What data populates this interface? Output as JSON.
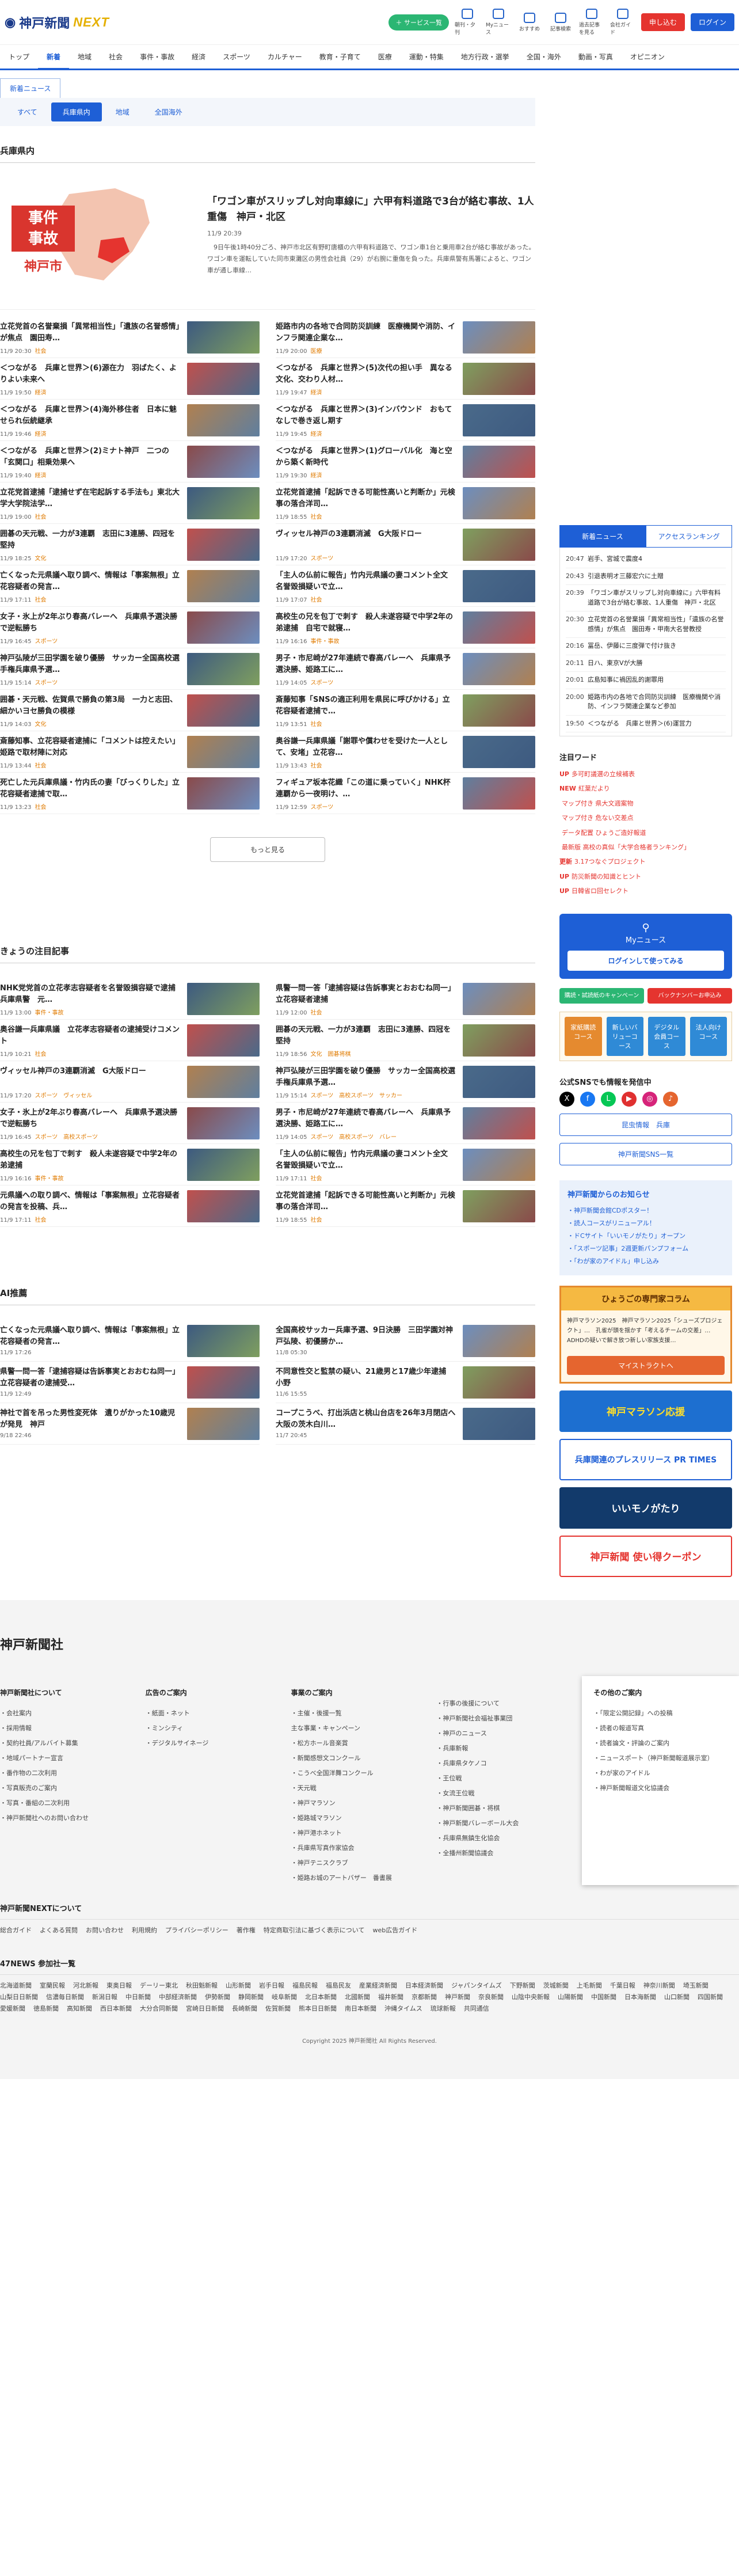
{
  "header": {
    "logo_text": "神戸新聞",
    "logo_next": "NEXT",
    "service_button": "＋ サービス一覧",
    "icons": [
      "朝刊・夕刊",
      "Myニュース",
      "おすすめ",
      "記事検索",
      "過去記事を見る",
      "会社ガイド"
    ],
    "signup": "申し込む",
    "login": "ログイン"
  },
  "nav": [
    "トップ",
    "新着",
    "地域",
    "社会",
    "事件・事故",
    "経済",
    "スポーツ",
    "カルチャー",
    "教育・子育て",
    "医療",
    "運動・特集",
    "地方行政・選挙",
    "全国・海外",
    "動画・写真",
    "オピニオン"
  ],
  "tabs": {
    "main": "新着ニュース",
    "sub": [
      "すべて",
      "兵庫県内",
      "地域",
      "全国海外"
    ]
  },
  "section": "兵庫県内",
  "featured": {
    "title": "「ワゴン車がスリップし対向車線に」六甲有料道路で3台が絡む事故、1人重傷　神戸・北区",
    "time": "11/9 20:39",
    "summary": "　9日午後1時40分ごろ、神戸市北区有野町唐櫃の六甲有料道路で、ワゴン車1台と乗用車2台が絡む事故があった。ワゴン車を運転していた同市東灘区の男性会社員（29）が右腕に重傷を負った。兵庫県警有馬署によると、ワゴン車が通し車線…",
    "badge_lines": [
      "事件",
      "事故"
    ],
    "badge_city": "神戸市"
  },
  "articles": [
    {
      "title": "立花党首の名誉棄損「異常相当性」「遺族の名誉感情」が焦点　園田寿…",
      "time": "11/9 20:30",
      "cat": "社会"
    },
    {
      "title": "姫路市内の各地で合同防災訓練　医療機関や消防、インフラ関連企業な…",
      "time": "11/9 20:00",
      "cat": "医療"
    },
    {
      "title": "＜つながる　兵庫と世界＞(6)源在力　羽ばたく、よりよい未来へ",
      "time": "11/9 19:50",
      "cat": "経済"
    },
    {
      "title": "＜つながる　兵庫と世界＞(5)次代の担い手　異なる文化、交わり人材…",
      "time": "11/9 19:47",
      "cat": "経済"
    },
    {
      "title": "＜つながる　兵庫と世界＞(4)海外移住者　日本に魅せられ伝統継承",
      "time": "11/9 19:46",
      "cat": "経済"
    },
    {
      "title": "＜つながる　兵庫と世界＞(3)インバウンド　おもてなしで巻き返し期す",
      "time": "11/9 19:45",
      "cat": "経済"
    },
    {
      "title": "＜つながる　兵庫と世界＞(2)ミナト神戸　二つの「玄関口」相乗効果へ",
      "time": "11/9 19:40",
      "cat": "経済"
    },
    {
      "title": "＜つながる　兵庫と世界＞(1)グローバル化　海と空から築く新時代",
      "time": "11/9 19:30",
      "cat": "経済"
    },
    {
      "title": "立花党首逮捕「逮捕せず在宅起訴する手法も」東北大学大学院法学…",
      "time": "11/9 19:00",
      "cat": "社会"
    },
    {
      "title": "立花党首逮捕「起訴できる可能性高いと判断か」元検事の落合洋司…",
      "time": "11/9 18:55",
      "cat": "社会"
    },
    {
      "title": "囲碁の天元戦、一力が3連覇　志田に3連勝、四冠を堅持",
      "time": "11/9 18:25",
      "cat": "文化"
    },
    {
      "title": "ヴィッセル神戸の3連覇消滅　G大阪ドロー",
      "time": "11/9 17:20",
      "cat": "スポーツ"
    },
    {
      "title": "亡くなった元県議へ取り調べ、情報は「事案無根」立花容疑者の発言…",
      "time": "11/9 17:11",
      "cat": "社会"
    },
    {
      "title": "「主人の仏前に報告」竹内元県議の妻コメント全文　名誉毀損疑いで立…",
      "time": "11/9 17:07",
      "cat": "社会"
    },
    {
      "title": "女子・氷上が2年ぶり春高バレーへ　兵庫県予選決勝で逆転勝ち",
      "time": "11/9 16:45",
      "cat": "スポーツ"
    },
    {
      "title": "高校生の兄を包丁で刺す　殺人未遂容疑で中学2年の弟逮捕　自宅で就寝…",
      "time": "11/9 16:16",
      "cat": "事件・事故"
    },
    {
      "title": "神戸弘陵が三田学園を破り優勝　サッカー全国高校選手権兵庫県予選…",
      "time": "11/9 15:14",
      "cat": "スポーツ"
    },
    {
      "title": "男子・市尼崎が27年連続で春高バレーへ　兵庫県予選決勝、姫路工に…",
      "time": "11/9 14:05",
      "cat": "スポーツ"
    },
    {
      "title": "囲碁・天元戦、佐賀県で勝負の第3局　一力と志田、細かいヨセ勝負の模様",
      "time": "11/9 14:03",
      "cat": "文化"
    },
    {
      "title": "斎藤知事「SNSの適正利用を県民に呼びかける」立花容疑者逮捕で…",
      "time": "11/9 13:51",
      "cat": "社会"
    },
    {
      "title": "斎藤知事、立花容疑者逮捕に「コメントは控えたい」姫路で取材陣に対応",
      "time": "11/9 13:44",
      "cat": "社会"
    },
    {
      "title": "奥谷謙一兵庫県議「謝罪や償わせを受けた一人として、安堵」立花容…",
      "time": "11/9 13:43",
      "cat": "社会"
    },
    {
      "title": "死亡した元兵庫県議・竹内氏の妻「びっくりした」立花容疑者逮捕で取…",
      "time": "11/9 13:23",
      "cat": "社会"
    },
    {
      "title": "フィギュア坂本花織「この道に乗っていく」NHK杯連覇から一夜明け、…",
      "time": "11/9 12:59",
      "cat": "スポーツ"
    }
  ],
  "more": "もっと見る",
  "picks_title": "きょうの注目記事",
  "picks": [
    {
      "title": "NHK党党首の立花孝志容疑者を名誉毀損容疑で逮捕　兵庫県警　元…",
      "time": "11/9 13:00",
      "cat": "事件・事故"
    },
    {
      "title": "県警一問一答「逮捕容疑は告訴事実とおおむね同一」立花容疑者逮捕",
      "time": "11/9 12:00",
      "cat": "社会"
    },
    {
      "title": "奥谷謙一兵庫県議　立花孝志容疑者の逮捕受けコメント",
      "time": "11/9 10:21",
      "cat": "社会"
    },
    {
      "title": "囲碁の天元戦、一力が3連覇　志田に3連勝、四冠を堅持",
      "time": "11/9 18:56",
      "cat": "文化　囲碁将棋"
    },
    {
      "title": "ヴィッセル神戸の3連覇消滅　G大阪ドロー",
      "time": "11/9 17:20",
      "cat": "スポーツ　ヴィッセル"
    },
    {
      "title": "神戸弘陵が三田学園を破り優勝　サッカー全国高校選手権兵庫県予選…",
      "time": "11/9 15:14",
      "cat": "スポーツ　高校スポーツ　サッカー"
    },
    {
      "title": "女子・氷上が2年ぶり春高バレーへ　兵庫県予選決勝で逆転勝ち",
      "time": "11/9 16:45",
      "cat": "スポーツ　高校スポーツ"
    },
    {
      "title": "男子・市尼崎が27年連続で春高バレーへ　兵庫県予選決勝、姫路工に…",
      "time": "11/9 14:05",
      "cat": "スポーツ　高校スポーツ　バレー"
    },
    {
      "title": "高校生の兄を包丁で刺す　殺人未遂容疑で中学2年の弟逮捕",
      "time": "11/9 16:16",
      "cat": "事件・事故"
    },
    {
      "title": "「主人の仏前に報告」竹内元県議の妻コメント全文　名誉毀損疑いで立…",
      "time": "11/9 17:11",
      "cat": "社会"
    },
    {
      "title": "元県議への取り調べ、情報は「事案無根」立花容疑者の発言を投稿、兵…",
      "time": "11/9 17:11",
      "cat": "社会"
    },
    {
      "title": "立花党首逮捕「起訴できる可能性高いと判断か」元検事の落合洋司…",
      "time": "11/9 18:55",
      "cat": "社会"
    }
  ],
  "ai_title": "AI推薦",
  "ai": [
    {
      "title": "亡くなった元県議へ取り調べ、情報は「事案無根」立花容疑者の発言…",
      "time": "11/9 17:26",
      "cat": ""
    },
    {
      "title": "全国高校サッカー兵庫予選、9日決勝　三田学園対神戸弘陵、初優勝か…",
      "time": "11/8 05:30",
      "cat": ""
    },
    {
      "title": "県警一問一答「逮捕容疑は告訴事実とおおむね同一」立花容疑者の逮捕受…",
      "time": "11/9 12:49",
      "cat": ""
    },
    {
      "title": "不同意性交と監禁の疑い、21歳男と17歳少年逮捕　小野",
      "time": "11/6 15:55",
      "cat": ""
    },
    {
      "title": "神社で首を吊った男性変死体　遺りがかった10歳児が発見　神戸",
      "time": "9/18 22:46",
      "cat": ""
    },
    {
      "title": "コープこうべ、打出浜店と桃山台店を26年3月閉店へ　大阪の茨木白川…",
      "time": "11/7 20:45",
      "cat": ""
    }
  ],
  "side": {
    "tabs": [
      "新着ニュース",
      "アクセスランキング"
    ],
    "ranking": [
      {
        "t": "20:47",
        "s": "岩手、宮城で震度4"
      },
      {
        "t": "20:43",
        "s": "引退表明オ三藤宏穴に土贈"
      },
      {
        "t": "20:39",
        "s": "「ワゴン車がスリップし対向車線に」六甲有料道路で3台が絡む事故、1人重傷　神戸・北区"
      },
      {
        "t": "20:30",
        "s": "立花党首の名誉棄損「異常相当性」「遺族の名誉感情」が焦点　園田寿・甲南大名誉教授"
      },
      {
        "t": "20:16",
        "s": "冨岳、伊藤に三度弾で付け抜き"
      },
      {
        "t": "20:11",
        "s": "日ハ、東京Vが大勝"
      },
      {
        "t": "20:01",
        "s": "広島知事に禍因乱的謝罪用"
      },
      {
        "t": "20:00",
        "s": "姫路市内の各地で合同防災訓練　医療機関や消防、インフラ関連企業など参加"
      },
      {
        "t": "19:50",
        "s": "＜つながる　兵庫と世界＞(6)運営力"
      }
    ],
    "kw_title": "注目ワード",
    "keywords": [
      {
        "tag": "UP",
        "text": "多可町議選の立候補表"
      },
      {
        "tag": "NEW",
        "text": "紅葉だより"
      },
      {
        "tag": "",
        "text": "マップ付き 県大文週案物"
      },
      {
        "tag": "",
        "text": "マップ付き 危ない交差点"
      },
      {
        "tag": "",
        "text": "データ配置 ひょうご造好報道"
      },
      {
        "tag": "",
        "text": "最新版 高校の真似「大学合格者ランキング」"
      },
      {
        "tag": "更新",
        "text": "3.17つなぐプロジェクト"
      },
      {
        "tag": "UP",
        "text": "防災新聞の知識とヒント"
      },
      {
        "tag": "UP",
        "text": "日韓省ロ回セレクト"
      }
    ],
    "mynews": "Myニュース",
    "mynews_btn": "ログインして使ってみる",
    "pills": [
      "購読・試読紙のキャンペーン",
      "バックナンバーお申込み"
    ],
    "digital_title": "デジタル",
    "digital": [
      "家紙購読コース",
      "新しいバリューコース",
      "デジタル会員コース",
      "法人向けコース"
    ],
    "sns_title": "公式SNSでも情報を発信中",
    "sns_buttons": [
      "昆虫情報　兵庫",
      "神戸新聞SNS一覧"
    ],
    "notice_title": "神戸新聞からのお知らせ",
    "notices": [
      "・神戸新聞会館CDポスター！",
      "・読人コースがリニューアル！",
      "・ドCサイト「いいモノがたり」オープン",
      "・「スポーツ記事」2週更新パンプフォーム",
      "・「わが家のアイドル」申し込み"
    ],
    "column_head": "ひょうごの専門家コラム",
    "column_body": "神戸マラソン2025　神戸マラソン2025「シューズプロジェクト」…　孔雀が頭を揺かす「考えるチームの交差」…　ADHDの疑いで解き放つ新しい家族支援…",
    "column_btn": "マイストラクトへ",
    "banners": [
      "神戸マラソン応援",
      "兵庫関連のプレスリリース PR TIMES",
      "いいモノがたり",
      "神戸新聞 使い得クーポン"
    ]
  },
  "footer": {
    "logo": "神戸新聞社",
    "cols": [
      {
        "h": "神戸新聞社について",
        "items": [
          "・会社案内",
          "・採用情報",
          "・契約社員/アルバイト募集",
          "・地域パートナー宣言",
          "・番作物の二次利用",
          "・写真販売のご案内",
          "・写真・番組の二次利用",
          "・神戸新聞社へのお問い合わせ"
        ]
      },
      {
        "h": "広告のご案内",
        "items": [
          "・紙面・ネット",
          "・ミンシティ",
          "・デジタルサイネージ"
        ]
      },
      {
        "h": "事業のご案内",
        "items": [
          "・主催・後援一覧",
          "主な事業・キャンペーン",
          "・松方ホール音楽賞",
          "・新聞感想文コンクール",
          "・こうべ全国洋舞コンクール",
          "・天元戦",
          "・神戸マラソン",
          "・姫路城マラソン",
          "・神戸港ホネット",
          "・兵庫県写真作家協会",
          "・神戸テニスクラブ",
          "・姫路お城のアートバザー　番書展"
        ]
      },
      {
        "h": "",
        "items": [
          "・行事の後援について",
          "・神戸新聞社会福祉事業団",
          "・神戸のニュース",
          "・兵庫新報",
          "・兵庫県タケノコ",
          "・王位戦",
          "・女流王位戦",
          "・神戸新聞囲碁・将棋",
          "・神戸新聞バレーボール大会",
          "・兵庫県無鎮生化協会",
          "・全播州新聞協議会"
        ]
      },
      {
        "h": "その他のご案内",
        "items": [
          "・「限定公開記録」への投稿",
          "・読者の報道写真",
          "・読者論文・評論のご案内",
          "・ニュースポート（神戸新聞報道展示室）",
          "・わが家のアイドル",
          "・神戸新聞報道文化協議会"
        ]
      }
    ],
    "next_title": "神戸新聞NEXTについて",
    "next_links": [
      "総合ガイド",
      "よくある質問",
      "お問い合わせ",
      "利用規約",
      "プライバシーポリシー",
      "著作権",
      "特定商取引法に基づく表示について",
      "web広告ガイド"
    ],
    "news_title": "47NEWS 参加社一覧",
    "papers": [
      "北海道新聞",
      "室蘭民報",
      "河北新報",
      "東奥日報",
      "デーリー東北",
      "秋田魁新報",
      "山形新聞",
      "岩手日報",
      "福島民報",
      "福島民友",
      "産業経済新聞",
      "日本経済新聞",
      "ジャパンタイムズ",
      "下野新聞",
      "茨城新聞",
      "上毛新聞",
      "千葉日報",
      "神奈川新聞",
      "埼玉新聞",
      "山梨日日新聞",
      "信濃毎日新聞",
      "新潟日報",
      "中日新聞",
      "中部経済新聞",
      "伊勢新聞",
      "静岡新聞",
      "岐阜新聞",
      "北日本新聞",
      "北國新聞",
      "福井新聞",
      "京都新聞",
      "神戸新聞",
      "奈良新聞",
      "山陰中央新報",
      "山陽新聞",
      "中国新聞",
      "日本海新聞",
      "山口新聞",
      "四国新聞",
      "愛媛新聞",
      "徳島新聞",
      "高知新聞",
      "西日本新聞",
      "大分合同新聞",
      "宮崎日日新聞",
      "長崎新聞",
      "佐賀新聞",
      "熊本日日新聞",
      "南日本新聞",
      "沖縄タイムス",
      "琉球新報",
      "共同通信"
    ],
    "copyright": "Copyright 2025 神戸新聞社 All Rights Reserved."
  }
}
